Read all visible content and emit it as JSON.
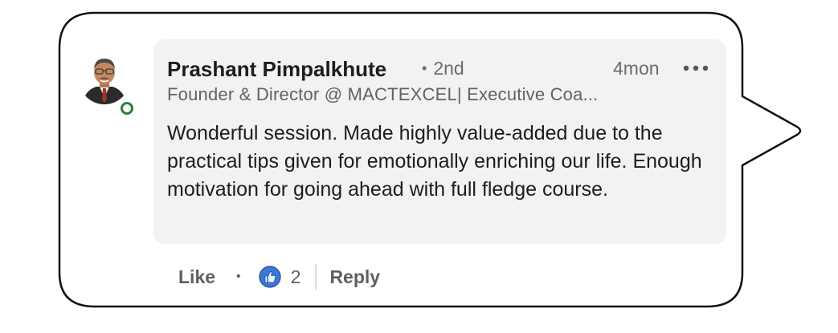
{
  "comment": {
    "author_name": "Prashant Pimpalkhute",
    "connection_degree": "2nd",
    "timestamp": "4mon",
    "headline": "Founder & Director @ MACTEXCEL| Executive Coa...",
    "text": "Wonderful session. Made highly value-added due to the practical tips given for emotionally enriching our life. Enough motivation for going ahead with full fledge course."
  },
  "actions": {
    "like_label": "Like",
    "reaction_count": "2",
    "reply_label": "Reply"
  },
  "icons": {
    "more": "more-options-icon",
    "reaction": "thumbs-up-icon",
    "presence": "online-status-icon"
  },
  "colors": {
    "card_background": "#f2f2f2",
    "presence_green": "#2e7d3a",
    "like_blue": "#3b78d8"
  }
}
